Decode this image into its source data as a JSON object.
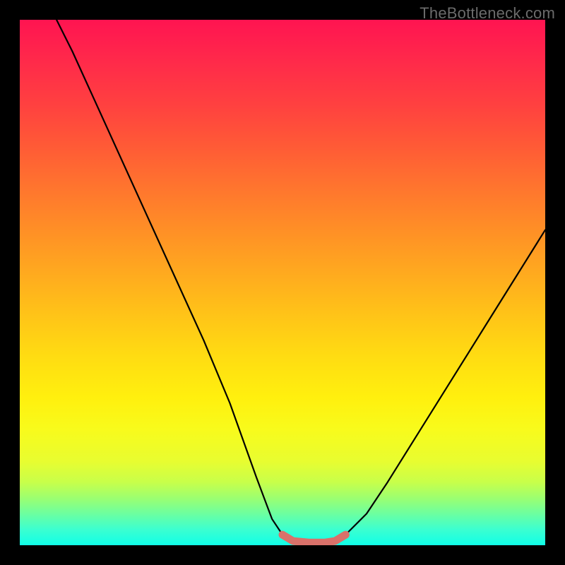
{
  "watermark": "TheBottleneck.com",
  "chart_data": {
    "type": "line",
    "title": "",
    "xlabel": "",
    "ylabel": "",
    "xlim": [
      0,
      100
    ],
    "ylim": [
      0,
      100
    ],
    "series": [
      {
        "name": "bottleneck-curve",
        "x": [
          7,
          10,
          15,
          20,
          25,
          30,
          35,
          40,
          45,
          48,
          50,
          52,
          55,
          58,
          60,
          62,
          66,
          70,
          75,
          80,
          85,
          90,
          95,
          100
        ],
        "y": [
          100,
          94,
          83,
          72,
          61,
          50,
          39,
          27,
          13,
          5,
          2,
          0.8,
          0.5,
          0.5,
          0.8,
          2,
          6,
          12,
          20,
          28,
          36,
          44,
          52,
          60
        ]
      },
      {
        "name": "flat-highlight",
        "x": [
          50,
          52,
          55,
          58,
          60,
          62
        ],
        "y": [
          2,
          0.8,
          0.5,
          0.5,
          0.8,
          2
        ]
      }
    ],
    "colors": {
      "curve": "#000000",
      "highlight": "#d9716a"
    }
  }
}
